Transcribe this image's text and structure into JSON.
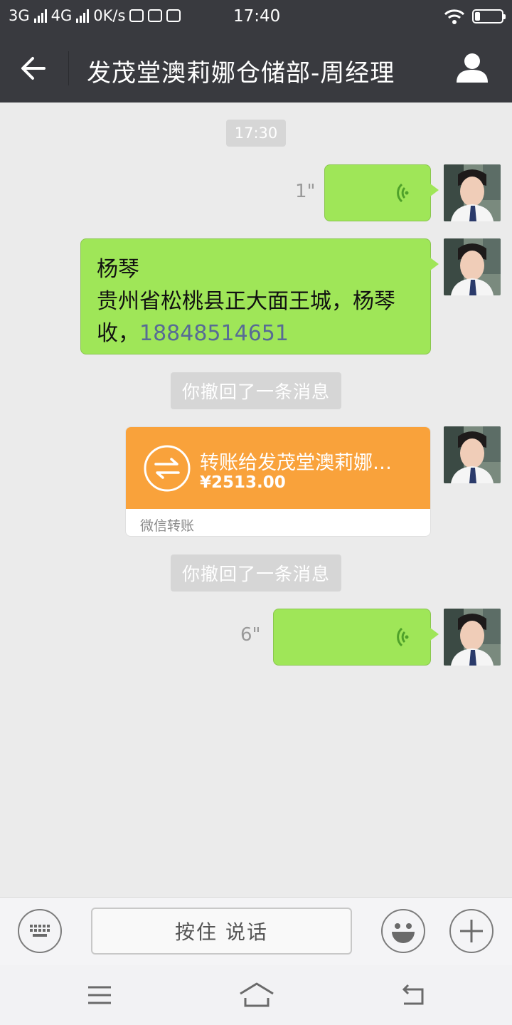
{
  "status_bar": {
    "net1": "3G",
    "net2": "4G",
    "speed": "0K/s",
    "time": "17:40",
    "battery_level": 0.2
  },
  "header": {
    "title": "发茂堂澳莉娜仓储部-周经理",
    "back_icon": "back-arrow-icon",
    "profile_icon": "person-icon"
  },
  "chat": {
    "timestamp": "17:30",
    "messages": [
      {
        "type": "voice",
        "duration": "1\""
      },
      {
        "type": "text",
        "line1": "杨琴",
        "line2": "贵州省松桃县正大面王城，杨琴",
        "line3_prefix": "收，",
        "phone": "18848514651"
      },
      {
        "type": "recall",
        "text": "你撤回了一条消息"
      },
      {
        "type": "transfer",
        "title": "转账给发茂堂澳莉娜…",
        "amount": "¥2513.00",
        "label": "微信转账"
      },
      {
        "type": "recall",
        "text": "你撤回了一条消息"
      },
      {
        "type": "voice",
        "duration": "6\""
      }
    ]
  },
  "input_bar": {
    "hold_to_talk": "按住 说话",
    "keyboard_icon": "keyboard-icon",
    "emoji_icon": "emoji-icon",
    "plus_icon": "plus-icon"
  },
  "nav_bar": {
    "menu_icon": "menu-icon",
    "home_icon": "home-icon",
    "back_icon": "return-icon"
  },
  "colors": {
    "header_bg": "#393a3f",
    "chat_bg": "#ebebeb",
    "bubble_green": "#9fe658",
    "transfer_orange": "#f9a23b",
    "link_blue": "#576b95"
  }
}
